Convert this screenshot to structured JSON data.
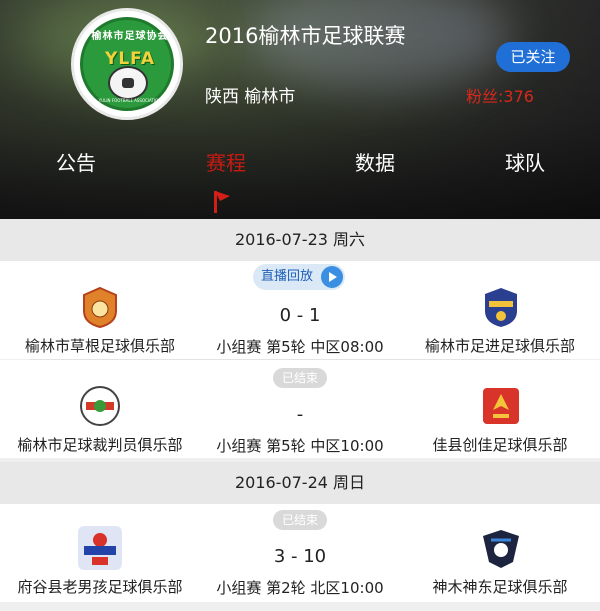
{
  "header": {
    "title": "2016榆林市足球联赛",
    "follow_label": "已关注",
    "location": "陕西 榆林市",
    "fans": "粉丝:376",
    "logo": {
      "ring_text": "榆林市足球协会",
      "abbr": "YLFA",
      "year": "2012",
      "bottom_text": "YULIN FOOTBALL ASSOCIATION"
    }
  },
  "tabs": [
    {
      "label": "公告"
    },
    {
      "label": "赛程",
      "active": true
    },
    {
      "label": "数据"
    },
    {
      "label": "球队"
    }
  ],
  "days": [
    {
      "date": "2016-07-23 周六",
      "matches": [
        {
          "status": "直播回放",
          "home": "榆林市草根足球俱乐部",
          "away": "榆林市足进足球俱乐部",
          "score": "0 - 1",
          "round": "小组赛 第5轮 中区08:00"
        },
        {
          "status": "已结束",
          "home": "榆林市足球裁判员俱乐部",
          "away": "佳县创佳足球俱乐部",
          "score": "-",
          "round": "小组赛 第5轮 中区10:00"
        }
      ]
    },
    {
      "date": "2016-07-24 周日",
      "matches": [
        {
          "status": "已结束",
          "home": "府谷县老男孩足球俱乐部",
          "away": "神木神东足球俱乐部",
          "score": "3 - 10",
          "round": "小组赛 第2轮 北区10:00"
        }
      ]
    }
  ],
  "colors": {
    "accent_red": "#c81a14",
    "follow_blue": "#1f6fd6"
  }
}
